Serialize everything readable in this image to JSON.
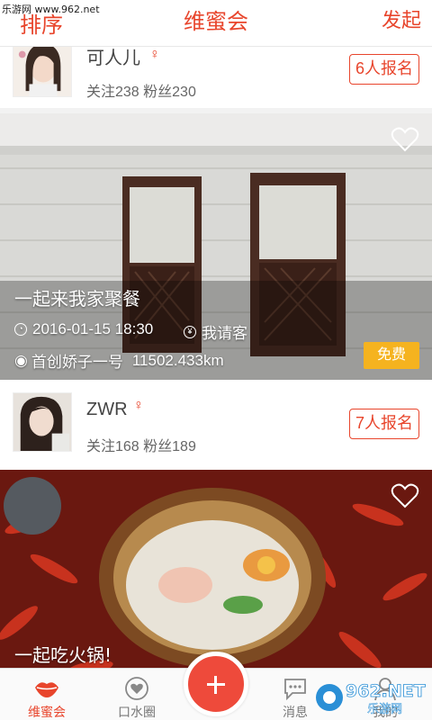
{
  "watermark": "乐游网 www.962.net",
  "header": {
    "left_label": "排序",
    "title": "维蜜会",
    "right_label": "发起"
  },
  "feed": [
    {
      "user": {
        "name": "可人儿",
        "gender_icon": "female-icon",
        "stats": "关注238 粉丝230"
      },
      "signup_label": "6人报名"
    },
    {
      "event": {
        "title": "一起来我家聚餐",
        "datetime": "2016-01-15 18:30",
        "payment": "我请客",
        "location": "首创娇子一号",
        "distance": "11502.433km",
        "price_badge": "免费"
      }
    },
    {
      "user": {
        "name": "ZWR",
        "gender_icon": "female-icon",
        "stats": "关注168 粉丝189"
      },
      "signup_label": "7人报名"
    },
    {
      "event": {
        "title": "一起吃火锅!"
      }
    }
  ],
  "tabbar": {
    "items": [
      {
        "label": "维蜜会",
        "icon": "lips-icon",
        "active": true
      },
      {
        "label": "口水圈",
        "icon": "heart-circle-icon",
        "active": false
      },
      {
        "label": "消息",
        "icon": "chat-bubble-icon",
        "active": false
      },
      {
        "label": "我的",
        "icon": "person-icon",
        "active": false
      }
    ],
    "center_action": "plus-icon"
  },
  "corner_logo": "962.NET 乐游网",
  "colors": {
    "accent": "#e8452c",
    "free_badge": "#f5b31f",
    "plus_button": "#ee4a3b"
  }
}
